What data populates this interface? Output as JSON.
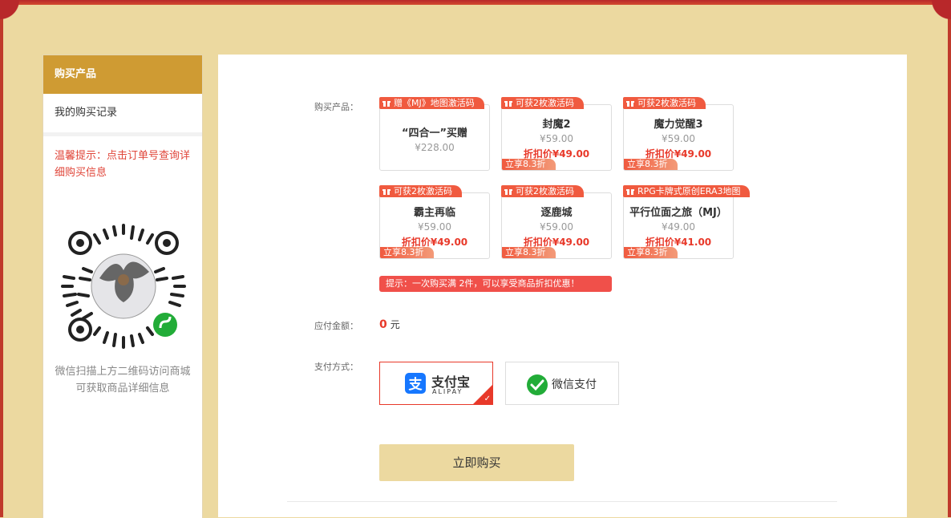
{
  "sidebar": {
    "active_item": "购买产品",
    "item_records": "我的购买记录",
    "tip": "温馨提示：点击订单号查询详细购买信息",
    "qr_caption": "微信扫描上方二维码访问商城可获取商品详细信息"
  },
  "form": {
    "products_label": "购买产品：",
    "amount_label": "应付金额：",
    "payment_label": "支付方式：",
    "amount_value": "0",
    "amount_unit": "元",
    "hint": "提示：一次购买满 2件，可以享受商品折扣优惠！",
    "buy_button": "立即购买"
  },
  "products": [
    {
      "tag": "赠《MJ》地图激活码",
      "name": "“四合一”买赠",
      "price": "¥228.00"
    },
    {
      "tag": "可获2枚激活码",
      "name": "封魔2",
      "price": "¥59.00",
      "discount": "折扣价¥49.00",
      "save": "立享8.3折"
    },
    {
      "tag": "可获2枚激活码",
      "name": "魔力觉醒3",
      "price": "¥59.00",
      "discount": "折扣价¥49.00",
      "save": "立享8.3折"
    },
    {
      "tag": "可获2枚激活码",
      "name": "霸主再临",
      "price": "¥59.00",
      "discount": "折扣价¥49.00",
      "save": "立享8.3折"
    },
    {
      "tag": "可获2枚激活码",
      "name": "逐鹿城",
      "price": "¥59.00",
      "discount": "折扣价¥49.00",
      "save": "立享8.3折"
    },
    {
      "tag": "RPG卡牌式原创ERA3地图",
      "name": "平行位面之旅（MJ）",
      "price": "¥49.00",
      "discount": "折扣价¥41.00",
      "save": "立享8.3折"
    }
  ],
  "payment": {
    "alipay_cn": "支付宝",
    "alipay_en": "ALIPAY",
    "wechat": "微信支付"
  },
  "colors": {
    "accent": "#cf9b33",
    "background": "#ecd9a0",
    "red": "#e8392a",
    "wechat_green": "#22ac38",
    "alipay_blue": "#1677ff"
  }
}
